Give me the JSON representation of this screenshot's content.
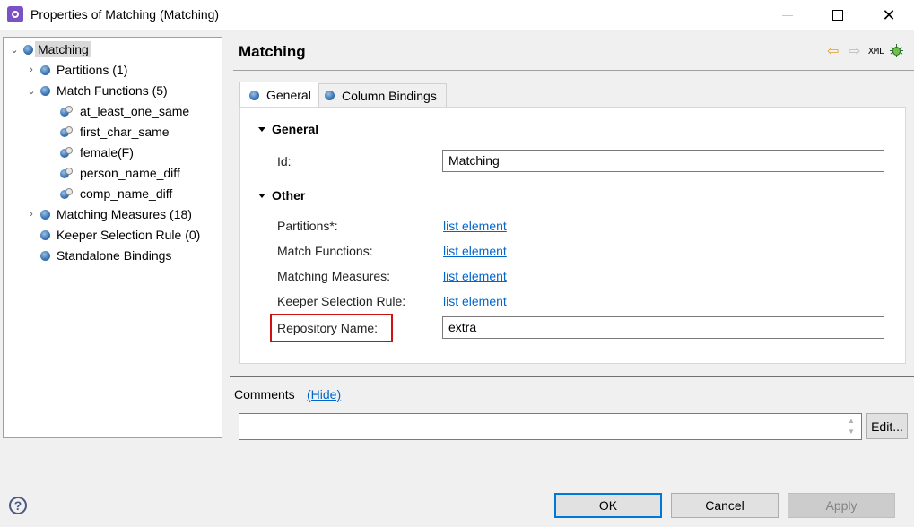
{
  "window": {
    "title": "Properties of Matching (Matching)",
    "controls": {
      "minimize": "minimize",
      "maximize": "maximize",
      "close": "✕"
    }
  },
  "tree": {
    "items": [
      {
        "label": "Matching",
        "toggle": "⌄",
        "icon": "blue-dot-icon",
        "selected": true
      },
      {
        "label": "Partitions (1)",
        "toggle": "›",
        "icon": "blue-dot-icon"
      },
      {
        "label": "Match Functions (5)",
        "toggle": "⌄",
        "icon": "blue-dot-icon"
      },
      {
        "label": "at_least_one_same",
        "icon": "function-icon"
      },
      {
        "label": "first_char_same",
        "icon": "function-icon"
      },
      {
        "label": "female(F)",
        "icon": "function-icon"
      },
      {
        "label": "person_name_diff",
        "icon": "function-icon"
      },
      {
        "label": "comp_name_diff",
        "icon": "function-icon"
      },
      {
        "label": "Matching Measures (18)",
        "toggle": "›",
        "icon": "blue-dot-icon"
      },
      {
        "label": "Keeper Selection Rule (0)",
        "icon": "blue-dot-icon"
      },
      {
        "label": "Standalone Bindings",
        "icon": "blue-dot-icon"
      }
    ]
  },
  "header": {
    "title": "Matching",
    "icons": {
      "back": "⇦",
      "forward": "⇨",
      "xml": "XML"
    }
  },
  "tabs": [
    {
      "label": "General",
      "active": true
    },
    {
      "label": "Column Bindings",
      "active": false
    }
  ],
  "general_section": {
    "title": "General",
    "id_label": "Id:",
    "id_value": "Matching"
  },
  "other_section": {
    "title": "Other",
    "rows": [
      {
        "label": "Partitions*:",
        "link": "list element"
      },
      {
        "label": "Match Functions:",
        "link": "list element"
      },
      {
        "label": "Matching Measures:",
        "link": "list element"
      },
      {
        "label": "Keeper Selection Rule:",
        "link": "list element"
      }
    ],
    "repository_label": "Repository Name:",
    "repository_value": "extra"
  },
  "comments": {
    "label": "Comments",
    "hide_link": "(Hide)",
    "value": "",
    "edit_button": "Edit..."
  },
  "footer": {
    "help": "?",
    "ok": "OK",
    "cancel": "Cancel",
    "apply": "Apply"
  },
  "colors": {
    "link": "#0066cc",
    "highlight": "#cc1111",
    "ok_focus": "#0078d7",
    "app_icon": "#7a52c4"
  }
}
